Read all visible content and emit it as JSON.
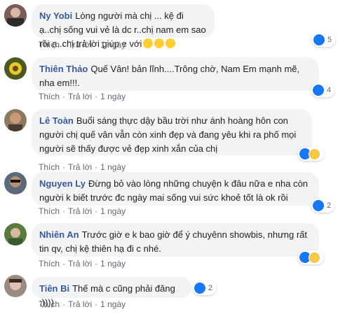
{
  "actions": {
    "like": "Thích",
    "reply": "Trả lời",
    "sep": "·"
  },
  "comments": [
    {
      "author": "Ny Yobi",
      "text": "Lòng người mà chị ... kệ đi ạ..chị sống vui vẻ là dc r..chị nam em sao rồi ạ..chị trả lời giúp e với",
      "emoji": [
        "crying-face",
        "crying-face",
        "crying-face"
      ],
      "time": "1 ngày",
      "reactions": {
        "types": [
          "like"
        ],
        "count": "5"
      }
    },
    {
      "author": "Thiên Thảo",
      "text": "Quế Vân! bản lĩnh....Trông chờ, Nam Em mạnh mẽ, nha em!!!.",
      "time": "1 ngày",
      "reactions": {
        "types": [
          "like"
        ],
        "count": "4"
      }
    },
    {
      "author": "Lê Toàn",
      "text": "Buổi sáng thực dậy bầu trời như ánh hoàng hôn con người chị quế vân vẫn còn xinh đẹp và đang yêu khi ra phố mọi người sẽ thấy được vẻ đẹp xinh xắn của chị",
      "time": "1 ngày",
      "reactions": {
        "types": [
          "like",
          "wow"
        ],
        "count": ""
      }
    },
    {
      "author": "Nguyen Ly",
      "text": "Đừng bỏ vào lòng những chuyện k đâu nữa e nha còn người k biết trước đc ngày mai sống vui sức khoẻ tốt là ok rồi",
      "time": "1 ngày",
      "reactions": {
        "types": [
          "like"
        ],
        "count": "2"
      }
    },
    {
      "author": "Nhiên An",
      "text": "Trước giờ e k bao giờ để ý chuyênn showbis, nhưng rất tin qv, chị kệ thiên hạ đi c nhé.",
      "time": "1 ngày",
      "reactions": {
        "types": [
          "like",
          "wow"
        ],
        "count": ""
      }
    },
    {
      "author": "Tiên Bi",
      "text": "Thế mà c cũng phải đăng :))))",
      "time": "1 ngày",
      "reactions": {
        "types": [
          "like"
        ],
        "count": "2"
      }
    }
  ],
  "colors": {
    "author": "#385898",
    "bubble": "#f2f3f5",
    "like": "#1877f2",
    "wow": "#f7c948",
    "meta": "#606770"
  }
}
